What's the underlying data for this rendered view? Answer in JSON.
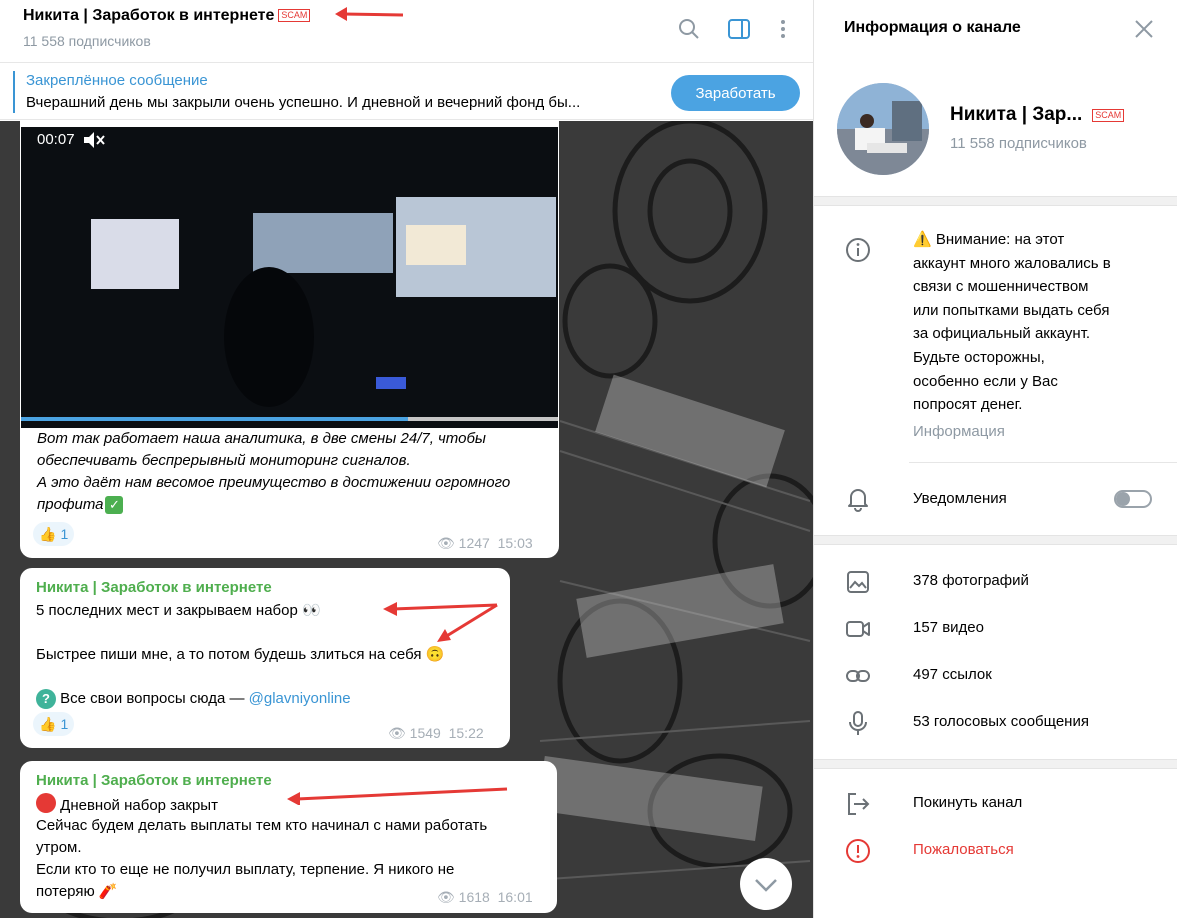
{
  "chat": {
    "title": "Никита | Заработок в интернете",
    "scam_badge": "SCAM",
    "subscribers": "11 558 подписчиков",
    "pinned": {
      "label": "Закреплённое сообщение",
      "text": "Вчерашний день мы закрыли очень успешно. И дневной и вечерний фонд бы...",
      "button": "Заработать"
    },
    "messages": [
      {
        "video_time": "00:07",
        "video_progress": 0.72,
        "lines": [
          "Вот так работает наша аналитика, в две смены 24/7, чтобы",
          "обеспечивать беспрерывный мониторинг сигналов.",
          "А это даёт нам весомое преимущество в достижении огромного",
          "профита"
        ],
        "reaction_count": "1",
        "views": "1247",
        "time": "15:03"
      },
      {
        "author": "Никита | Заработок в интернете",
        "line1": "5 последних мест и закрываем набор",
        "line2": "Быстрее пиши мне, а то потом будешь злиться на  себя",
        "line3": "Все свои вопросы сюда —",
        "link": "@glavniyonline",
        "reaction_count": "1",
        "views": "1549",
        "time": "15:22"
      },
      {
        "author": "Никита | Заработок в интернете",
        "line1": "Дневной набор закрыт",
        "line2": "Сейчас будем делать выплаты тем кто начинал с нами работать",
        "line3": "утром.",
        "line4": "Если кто то еще не получил выплату, терпение. Я никого не",
        "line5": "потеряю",
        "views": "1618",
        "time": "16:01"
      }
    ]
  },
  "panel": {
    "title": "Информация о канале",
    "channel_name": "Никита | Зар...",
    "scam_badge": "SCAM",
    "subscribers": "11 558 подписчиков",
    "warning_lines": [
      "⚠️ Внимание: на этот",
      "аккаунт много жаловались в",
      "связи с мошенничеством",
      "или попытками выдать себя",
      "за официальный аккаунт.",
      "Будьте осторожны,",
      "особенно если у Вас",
      "попросят денег."
    ],
    "info_label": "Информация",
    "notifications_label": "Уведомления",
    "notifications_on": false,
    "media": {
      "photos": "378 фотографий",
      "videos": "157 видео",
      "links": "497 ссылок",
      "voice": "53 голосовых сообщения"
    },
    "leave": "Покинуть канал",
    "report": "Пожаловаться"
  },
  "colors": {
    "accent": "#3a95d4",
    "author": "#4fae4e",
    "danger": "#e53935"
  }
}
